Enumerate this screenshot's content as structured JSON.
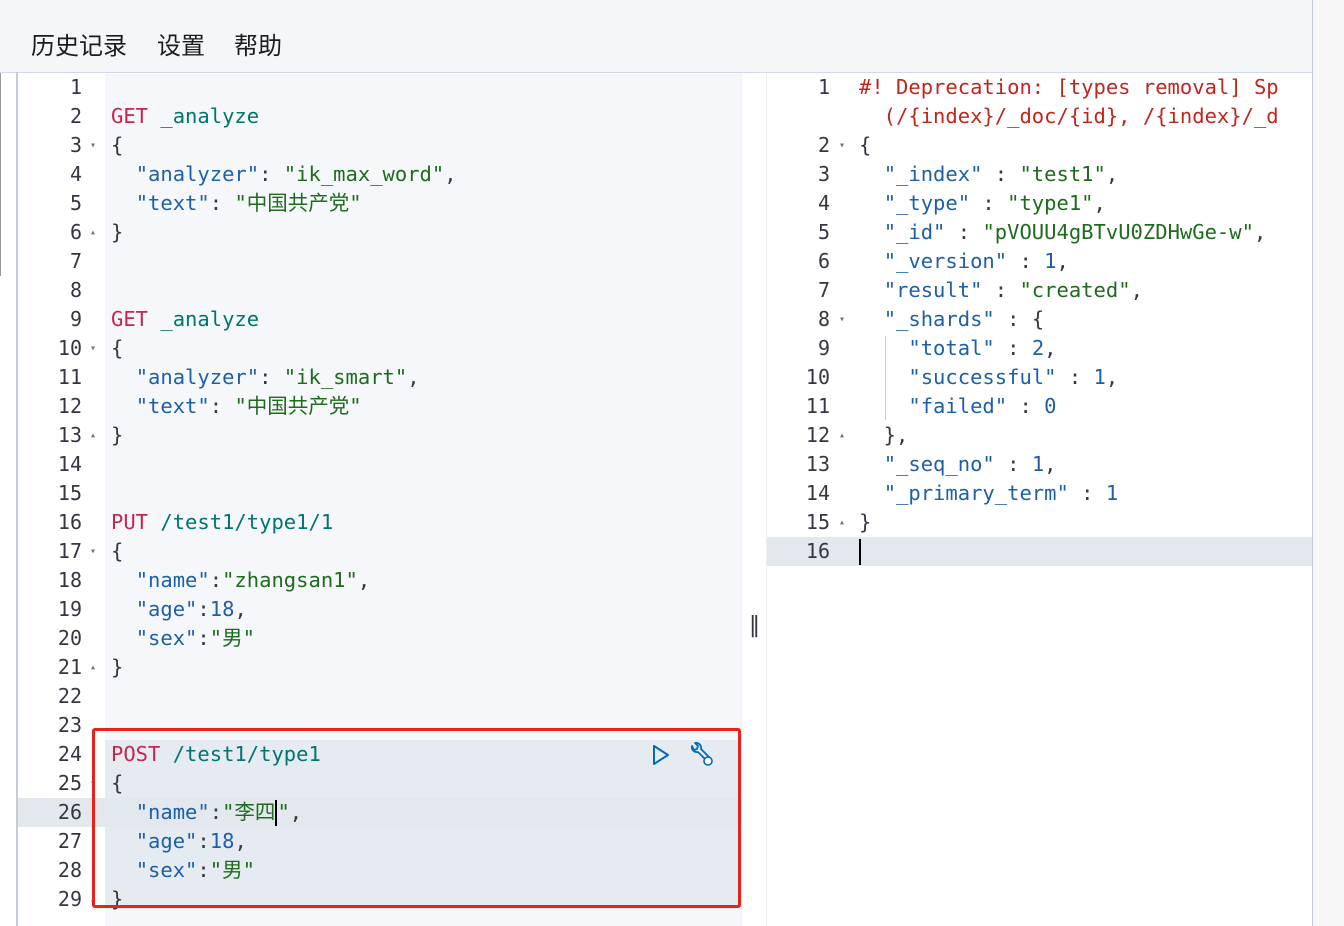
{
  "menu": {
    "items": [
      "历史记录",
      "设置",
      "帮助"
    ]
  },
  "request_editor": {
    "lines": [
      {
        "n": "1",
        "fold": "",
        "tokens": []
      },
      {
        "n": "2",
        "fold": "",
        "tokens": [
          [
            "method",
            "GET"
          ],
          [
            "url",
            " _analyze"
          ]
        ]
      },
      {
        "n": "3",
        "fold": "▾",
        "tokens": [
          [
            "punc",
            "{"
          ]
        ]
      },
      {
        "n": "4",
        "fold": "",
        "tokens": [
          [
            "punc",
            "  "
          ],
          [
            "key",
            "\"analyzer\""
          ],
          [
            "punc",
            ": "
          ],
          [
            "str",
            "\"ik_max_word\""
          ],
          [
            "punc",
            ","
          ]
        ]
      },
      {
        "n": "5",
        "fold": "",
        "tokens": [
          [
            "punc",
            "  "
          ],
          [
            "key",
            "\"text\""
          ],
          [
            "punc",
            ": "
          ],
          [
            "str",
            "\"中国共产党\""
          ]
        ]
      },
      {
        "n": "6",
        "fold": "▴",
        "tokens": [
          [
            "punc",
            "}"
          ]
        ]
      },
      {
        "n": "7",
        "fold": "",
        "tokens": []
      },
      {
        "n": "8",
        "fold": "",
        "tokens": []
      },
      {
        "n": "9",
        "fold": "",
        "tokens": [
          [
            "method",
            "GET"
          ],
          [
            "url",
            " _analyze"
          ]
        ]
      },
      {
        "n": "10",
        "fold": "▾",
        "tokens": [
          [
            "punc",
            "{"
          ]
        ]
      },
      {
        "n": "11",
        "fold": "",
        "tokens": [
          [
            "punc",
            "  "
          ],
          [
            "key",
            "\"analyzer\""
          ],
          [
            "punc",
            ": "
          ],
          [
            "str",
            "\"ik_smart\""
          ],
          [
            "punc",
            ","
          ]
        ]
      },
      {
        "n": "12",
        "fold": "",
        "tokens": [
          [
            "punc",
            "  "
          ],
          [
            "key",
            "\"text\""
          ],
          [
            "punc",
            ": "
          ],
          [
            "str",
            "\"中国共产党\""
          ]
        ]
      },
      {
        "n": "13",
        "fold": "▴",
        "tokens": [
          [
            "punc",
            "}"
          ]
        ]
      },
      {
        "n": "14",
        "fold": "",
        "tokens": []
      },
      {
        "n": "15",
        "fold": "",
        "tokens": []
      },
      {
        "n": "16",
        "fold": "",
        "tokens": [
          [
            "method",
            "PUT"
          ],
          [
            "url",
            " /test1/type1/1"
          ]
        ]
      },
      {
        "n": "17",
        "fold": "▾",
        "tokens": [
          [
            "punc",
            "{"
          ]
        ]
      },
      {
        "n": "18",
        "fold": "",
        "tokens": [
          [
            "punc",
            "  "
          ],
          [
            "key",
            "\"name\""
          ],
          [
            "punc",
            ":"
          ],
          [
            "str",
            "\"zhangsan1\""
          ],
          [
            "punc",
            ","
          ]
        ]
      },
      {
        "n": "19",
        "fold": "",
        "tokens": [
          [
            "punc",
            "  "
          ],
          [
            "key",
            "\"age\""
          ],
          [
            "punc",
            ":"
          ],
          [
            "num",
            "18"
          ],
          [
            "punc",
            ","
          ]
        ]
      },
      {
        "n": "20",
        "fold": "",
        "tokens": [
          [
            "punc",
            "  "
          ],
          [
            "key",
            "\"sex\""
          ],
          [
            "punc",
            ":"
          ],
          [
            "str",
            "\"男\""
          ]
        ]
      },
      {
        "n": "21",
        "fold": "▴",
        "tokens": [
          [
            "punc",
            "}"
          ]
        ]
      },
      {
        "n": "22",
        "fold": "",
        "tokens": []
      },
      {
        "n": "23",
        "fold": "",
        "tokens": []
      },
      {
        "n": "24",
        "fold": "",
        "tokens": [
          [
            "method",
            "POST"
          ],
          [
            "url",
            " /test1/type1"
          ]
        ]
      },
      {
        "n": "25",
        "fold": "▾",
        "tokens": [
          [
            "punc",
            "{"
          ]
        ]
      },
      {
        "n": "26",
        "fold": "",
        "tokens": [
          [
            "punc",
            "  "
          ],
          [
            "key",
            "\"name\""
          ],
          [
            "punc",
            ":"
          ],
          [
            "str",
            "\"李四"
          ],
          [
            "cursor",
            ""
          ],
          [
            "str",
            "\""
          ],
          [
            "punc",
            ","
          ]
        ]
      },
      {
        "n": "27",
        "fold": "",
        "tokens": [
          [
            "punc",
            "  "
          ],
          [
            "key",
            "\"age\""
          ],
          [
            "punc",
            ":"
          ],
          [
            "num",
            "18"
          ],
          [
            "punc",
            ","
          ]
        ]
      },
      {
        "n": "28",
        "fold": "",
        "tokens": [
          [
            "punc",
            "  "
          ],
          [
            "key",
            "\"sex\""
          ],
          [
            "punc",
            ":"
          ],
          [
            "str",
            "\"男\""
          ]
        ]
      },
      {
        "n": "29",
        "fold": "▴",
        "tokens": [
          [
            "punc",
            "}"
          ]
        ]
      }
    ],
    "active_line": "26",
    "selected_request_lines": [
      "24",
      "29"
    ],
    "actions": {
      "run_icon": "play-icon",
      "settings_icon": "wrench-icon"
    }
  },
  "response_editor": {
    "lines": [
      {
        "n": "1",
        "fold": "",
        "tokens": [
          [
            "warn",
            "#! Deprecation: [types removal] Sp"
          ]
        ]
      },
      {
        "n": "",
        "fold": "",
        "tokens": [
          [
            "warn",
            "  (/{index}/_doc/{id}, /{index}/_d"
          ]
        ]
      },
      {
        "n": "2",
        "fold": "▾",
        "tokens": [
          [
            "punc",
            "{"
          ]
        ]
      },
      {
        "n": "3",
        "fold": "",
        "tokens": [
          [
            "punc",
            "  "
          ],
          [
            "key",
            "\"_index\""
          ],
          [
            "punc",
            " : "
          ],
          [
            "str",
            "\"test1\""
          ],
          [
            "punc",
            ","
          ]
        ]
      },
      {
        "n": "4",
        "fold": "",
        "tokens": [
          [
            "punc",
            "  "
          ],
          [
            "key",
            "\"_type\""
          ],
          [
            "punc",
            " : "
          ],
          [
            "str",
            "\"type1\""
          ],
          [
            "punc",
            ","
          ]
        ]
      },
      {
        "n": "5",
        "fold": "",
        "tokens": [
          [
            "punc",
            "  "
          ],
          [
            "key",
            "\"_id\""
          ],
          [
            "punc",
            " : "
          ],
          [
            "str",
            "\"pVOUU4gBTvU0ZDHwGe-w\""
          ],
          [
            "punc",
            ","
          ]
        ]
      },
      {
        "n": "6",
        "fold": "",
        "tokens": [
          [
            "punc",
            "  "
          ],
          [
            "key",
            "\"_version\""
          ],
          [
            "punc",
            " : "
          ],
          [
            "num",
            "1"
          ],
          [
            "punc",
            ","
          ]
        ]
      },
      {
        "n": "7",
        "fold": "",
        "tokens": [
          [
            "punc",
            "  "
          ],
          [
            "key",
            "\"result\""
          ],
          [
            "punc",
            " : "
          ],
          [
            "str",
            "\"created\""
          ],
          [
            "punc",
            ","
          ]
        ]
      },
      {
        "n": "8",
        "fold": "▾",
        "tokens": [
          [
            "punc",
            "  "
          ],
          [
            "key",
            "\"_shards\""
          ],
          [
            "punc",
            " : {"
          ]
        ]
      },
      {
        "n": "9",
        "fold": "",
        "tokens": [
          [
            "punc",
            "    "
          ],
          [
            "key",
            "\"total\""
          ],
          [
            "punc",
            " : "
          ],
          [
            "num",
            "2"
          ],
          [
            "punc",
            ","
          ]
        ]
      },
      {
        "n": "10",
        "fold": "",
        "tokens": [
          [
            "punc",
            "    "
          ],
          [
            "key",
            "\"successful\""
          ],
          [
            "punc",
            " : "
          ],
          [
            "num",
            "1"
          ],
          [
            "punc",
            ","
          ]
        ]
      },
      {
        "n": "11",
        "fold": "",
        "tokens": [
          [
            "punc",
            "    "
          ],
          [
            "key",
            "\"failed\""
          ],
          [
            "punc",
            " : "
          ],
          [
            "num",
            "0"
          ]
        ]
      },
      {
        "n": "12",
        "fold": "▴",
        "tokens": [
          [
            "punc",
            "  },"
          ]
        ]
      },
      {
        "n": "13",
        "fold": "",
        "tokens": [
          [
            "punc",
            "  "
          ],
          [
            "key",
            "\"_seq_no\""
          ],
          [
            "punc",
            " : "
          ],
          [
            "num",
            "1"
          ],
          [
            "punc",
            ","
          ]
        ]
      },
      {
        "n": "14",
        "fold": "",
        "tokens": [
          [
            "punc",
            "  "
          ],
          [
            "key",
            "\"_primary_term\""
          ],
          [
            "punc",
            " : "
          ],
          [
            "num",
            "1"
          ]
        ]
      },
      {
        "n": "15",
        "fold": "▴",
        "tokens": [
          [
            "punc",
            "}"
          ]
        ]
      },
      {
        "n": "16",
        "fold": "",
        "tokens": [
          [
            "cursor",
            ""
          ]
        ]
      }
    ],
    "active_line": "16"
  },
  "resizer": {
    "grip": "‖"
  },
  "colors": {
    "method": "#c7254e",
    "url": "#00756e",
    "string": "#1e6b1e",
    "key": "#1d5fa8",
    "warning": "#bd271e",
    "highlight_box": "#e8221b"
  }
}
